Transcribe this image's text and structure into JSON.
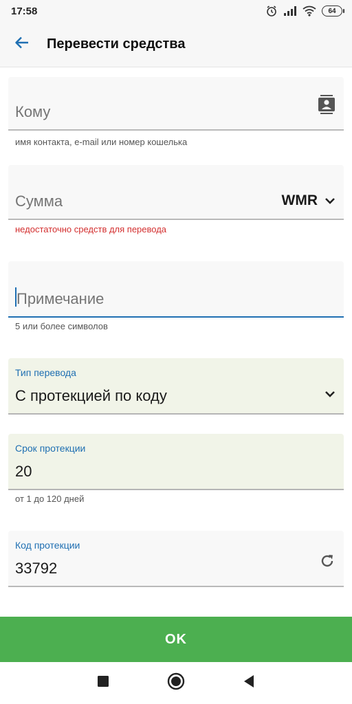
{
  "status_bar": {
    "time": "17:58",
    "battery": "64",
    "icons": [
      "alarm-icon",
      "signal-icon",
      "wifi-icon",
      "battery-icon"
    ]
  },
  "app_bar": {
    "title": "Перевести средства",
    "back_icon": "arrow-left-icon"
  },
  "form": {
    "recipient": {
      "placeholder": "Кому",
      "helper": "имя контакта, e-mail или номер кошелька",
      "icon": "contacts-icon"
    },
    "amount": {
      "placeholder": "Сумма",
      "currency": "WMR",
      "error": "недостаточно средств для перевода"
    },
    "note": {
      "placeholder": "Примечание",
      "helper": "5 или более символов"
    },
    "transfer_type": {
      "label": "Тип перевода",
      "value": "С протекцией по коду"
    },
    "protection_period": {
      "label": "Срок протекции",
      "value": "20",
      "helper": "от 1 до 120 дней"
    },
    "protection_code": {
      "label": "Код протекции",
      "value": "33792",
      "icon": "refresh-icon"
    }
  },
  "ok_button": "OK",
  "colors": {
    "accent": "#1f6fb2",
    "error": "#d32f2f",
    "ok_button": "#4caf50",
    "filled_field": "#f1f4e8"
  },
  "nav_bar": [
    "recents-square-icon",
    "home-circle-icon",
    "back-triangle-icon"
  ]
}
